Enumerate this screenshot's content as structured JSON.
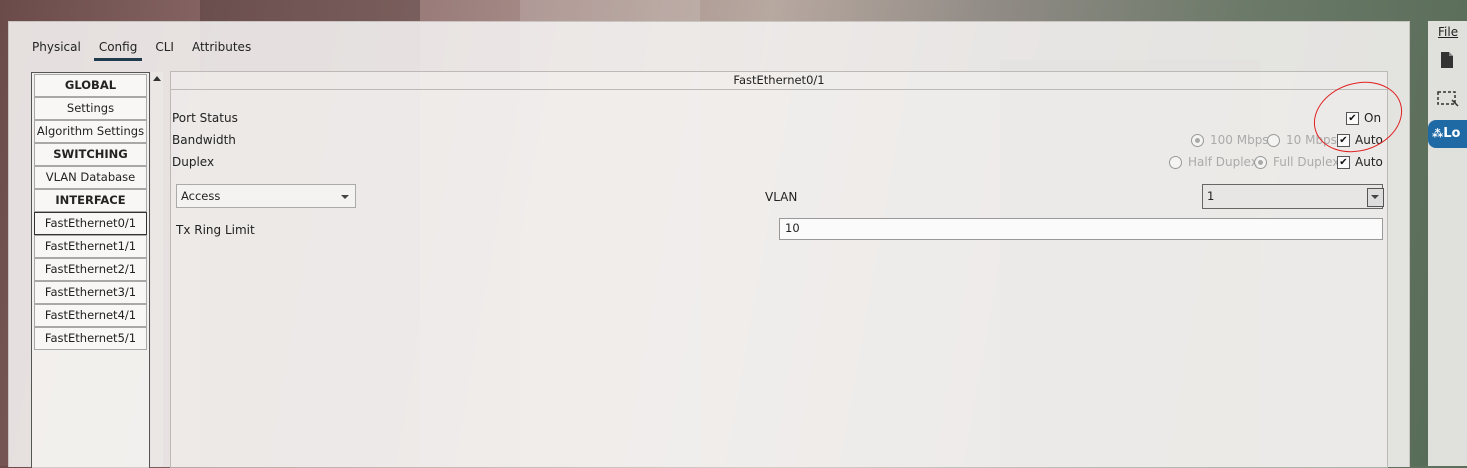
{
  "tabs": [
    "Physical",
    "Config",
    "CLI",
    "Attributes"
  ],
  "active_tab": "Config",
  "sidebar": {
    "items": [
      {
        "label": "GLOBAL",
        "header": true
      },
      {
        "label": "Settings"
      },
      {
        "label": "Algorithm Settings"
      },
      {
        "label": "SWITCHING",
        "header": true
      },
      {
        "label": "VLAN Database"
      },
      {
        "label": "INTERFACE",
        "header": true
      },
      {
        "label": "FastEthernet0/1",
        "selected": true
      },
      {
        "label": "FastEthernet1/1"
      },
      {
        "label": "FastEthernet2/1"
      },
      {
        "label": "FastEthernet3/1"
      },
      {
        "label": "FastEthernet4/1"
      },
      {
        "label": "FastEthernet5/1"
      }
    ]
  },
  "panel": {
    "title": "FastEthernet0/1",
    "port_status": {
      "label": "Port Status",
      "on_label": "On",
      "checked": true
    },
    "bandwidth": {
      "label": "Bandwidth",
      "opt1": "100 Mbps",
      "opt2": "10 Mbps",
      "auto_label": "Auto",
      "auto_checked": true
    },
    "duplex": {
      "label": "Duplex",
      "opt1": "Half Duplex",
      "opt2": "Full Duplex",
      "auto_label": "Auto",
      "auto_checked": true
    },
    "mode": {
      "value": "Access"
    },
    "vlan": {
      "label": "VLAN",
      "value": "1"
    },
    "tx_ring": {
      "label": "Tx Ring Limit",
      "value": "10"
    }
  },
  "right_panel": {
    "file_menu": "File",
    "button_label": "Lo"
  },
  "colors": {
    "annotation": "#e02020",
    "tab_underline": "#1f3b4d",
    "accent": "#1f6aa5"
  }
}
